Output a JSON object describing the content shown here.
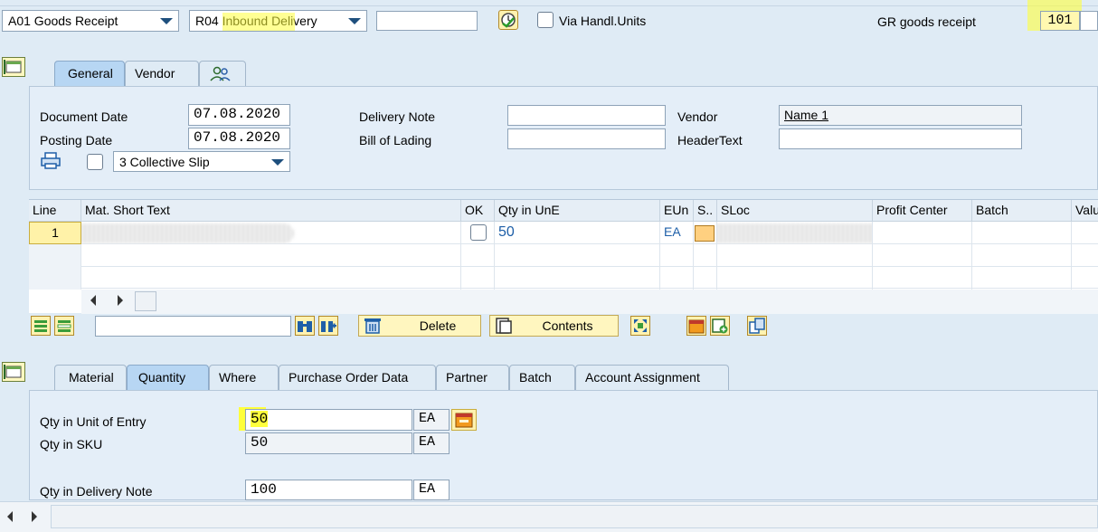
{
  "top": {
    "action": "A01 Goods Receipt",
    "reference_doc": "R04 Inbound Delivery",
    "reference_value": "",
    "via_handl_units": "Via Handl.Units",
    "gr_label": "GR goods receipt",
    "movement_type": "101"
  },
  "header_tabs": [
    "General",
    "Vendor"
  ],
  "header": {
    "document_date_label": "Document Date",
    "document_date": "07.08.2020",
    "posting_date_label": "Posting Date",
    "posting_date": "07.08.2020",
    "delivery_note_label": "Delivery Note",
    "delivery_note": "",
    "bill_of_lading_label": "Bill of Lading",
    "bill_of_lading": "",
    "vendor_label": "Vendor",
    "vendor": "Name 1",
    "header_text_label": "HeaderText",
    "header_text": "",
    "slip_option": "3 Collective Slip"
  },
  "grid": {
    "columns": [
      "Line",
      "Mat. Short Text",
      "OK",
      "Qty in UnE",
      "EUn",
      "S..",
      "SLoc",
      "Profit Center",
      "Batch",
      "Valu"
    ],
    "rows": [
      {
        "line": "1",
        "qty": "50",
        "eun": "EA"
      }
    ]
  },
  "toolbar": {
    "delete_label": "Delete",
    "contents_label": "Contents",
    "search_value": ""
  },
  "detail_tabs": [
    "Material",
    "Quantity",
    "Where",
    "Purchase Order Data",
    "Partner",
    "Batch",
    "Account Assignment"
  ],
  "detail": {
    "qty_entry_label": "Qty in Unit of Entry",
    "qty_entry": "50",
    "qty_entry_unit": "EA",
    "qty_sku_label": "Qty in SKU",
    "qty_sku": "50",
    "qty_sku_unit": "EA",
    "qty_delivery_label": "Qty in Delivery Note",
    "qty_delivery": "100",
    "qty_delivery_unit": "EA"
  },
  "colors": {
    "highlight": "#ffff3c",
    "active_tab": "#b7d6f3",
    "background": "#dfebf5",
    "link_blue": "#1e5fa8"
  }
}
